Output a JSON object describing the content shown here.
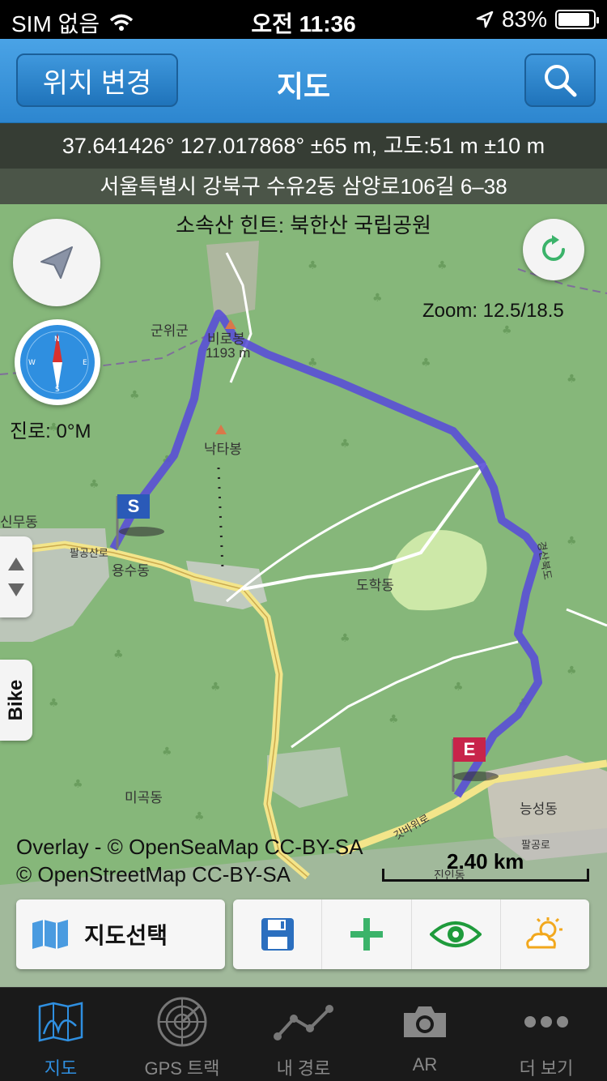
{
  "status": {
    "carrier": "SIM 없음",
    "time": "오전 11:36",
    "battery": "83%",
    "battery_level": 0.83
  },
  "nav": {
    "left_button": "위치 변경",
    "title": "지도",
    "search_icon": "search-icon"
  },
  "map": {
    "coords": "37.641426° 127.017868° ±65 m, 고도:51 m ±10 m",
    "address": "서울특별시 강북구 수유2동 삼양로106길 6–38",
    "hint": "소속산 힌트: 북한산 국립공원",
    "zoom": "Zoom: 12.5/18.5",
    "heading": "진로: 0°M",
    "side_tab": "Bike",
    "marker_start": "S",
    "marker_end": "E",
    "place_labels": {
      "gunwigun": "군위군",
      "peak": "비로봉",
      "peak_alt": "1193 m",
      "naktabong": "낙타봉",
      "sinmudong": "신무동",
      "yongsudong": "용수동",
      "road1": "팔공산로",
      "dohakdong": "도학동",
      "road2": "경산북도",
      "migokdong": "미곡동",
      "neungseongdong": "능성동",
      "road3": "팔공로",
      "road4": "갓바위로",
      "jininng": "진인동"
    },
    "credits": [
      "Overlay - © OpenSeaMap CC-BY-SA",
      "© OpenStreetMap CC-BY-SA"
    ],
    "scale": "2.40 km"
  },
  "toolbar": {
    "map_select": "지도선택"
  },
  "tabs": [
    {
      "label": "지도",
      "icon": "map-icon",
      "active": true
    },
    {
      "label": "GPS 트랙",
      "icon": "radar-icon",
      "active": false
    },
    {
      "label": "내 경로",
      "icon": "route-icon",
      "active": false
    },
    {
      "label": "AR",
      "icon": "camera-icon",
      "active": false
    },
    {
      "label": "더 보기",
      "icon": "more-icon",
      "active": false
    }
  ],
  "colors": {
    "accent": "#2f8fe0",
    "route": "#5a4fd6",
    "map_green": "#86b77a"
  }
}
